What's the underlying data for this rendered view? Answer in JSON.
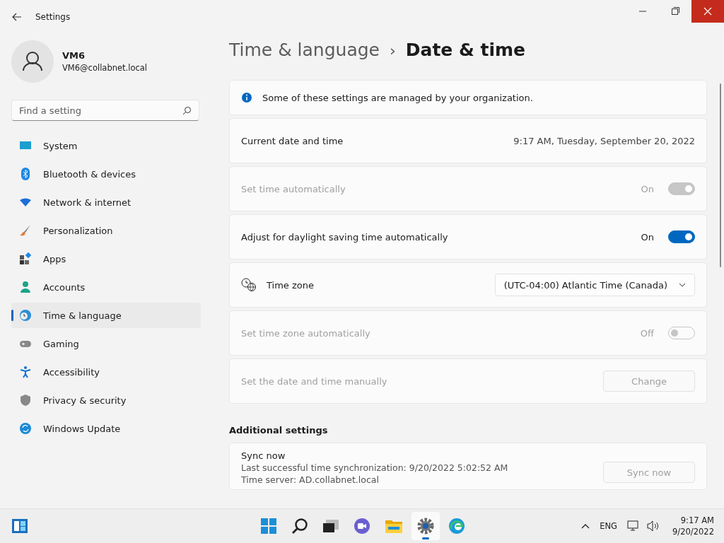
{
  "window": {
    "title": "Settings"
  },
  "user": {
    "name": "VM6",
    "email": "VM6@collabnet.local"
  },
  "search": {
    "placeholder": "Find a setting"
  },
  "nav": [
    {
      "label": "System",
      "selected": false
    },
    {
      "label": "Bluetooth & devices",
      "selected": false
    },
    {
      "label": "Network & internet",
      "selected": false
    },
    {
      "label": "Personalization",
      "selected": false
    },
    {
      "label": "Apps",
      "selected": false
    },
    {
      "label": "Accounts",
      "selected": false
    },
    {
      "label": "Time & language",
      "selected": true
    },
    {
      "label": "Gaming",
      "selected": false
    },
    {
      "label": "Accessibility",
      "selected": false
    },
    {
      "label": "Privacy & security",
      "selected": false
    },
    {
      "label": "Windows Update",
      "selected": false
    }
  ],
  "breadcrumb": {
    "parent": "Time & language",
    "separator": "›",
    "current": "Date & time"
  },
  "rows": [
    {
      "kind": "info",
      "label": "Some of these settings are managed by your organization."
    },
    {
      "kind": "value",
      "label": "Current date and time",
      "value": "9:17 AM, Tuesday, September 20, 2022"
    },
    {
      "kind": "toggle",
      "label": "Set time automatically",
      "state_text": "On",
      "on": true,
      "disabled": true
    },
    {
      "kind": "toggle",
      "label": "Adjust for daylight saving time automatically",
      "state_text": "On",
      "on": true,
      "disabled": false
    },
    {
      "kind": "dropdown",
      "label": "Time zone",
      "value": "(UTC-04:00) Atlantic Time (Canada)"
    },
    {
      "kind": "toggle",
      "label": "Set time zone automatically",
      "state_text": "Off",
      "on": false,
      "disabled": true
    },
    {
      "kind": "button",
      "label": "Set the date and time manually",
      "button": "Change",
      "disabled": true
    }
  ],
  "additional": {
    "heading": "Additional settings",
    "title": "Sync now",
    "lines": [
      "Last successful time synchronization: 9/20/2022 5:02:52 AM",
      "Time server: AD.collabnet.local"
    ],
    "button": "Sync now",
    "disabled": true
  },
  "taskbar": {
    "language": "ENG",
    "time": "9:17 AM",
    "date": "9/20/2022"
  }
}
